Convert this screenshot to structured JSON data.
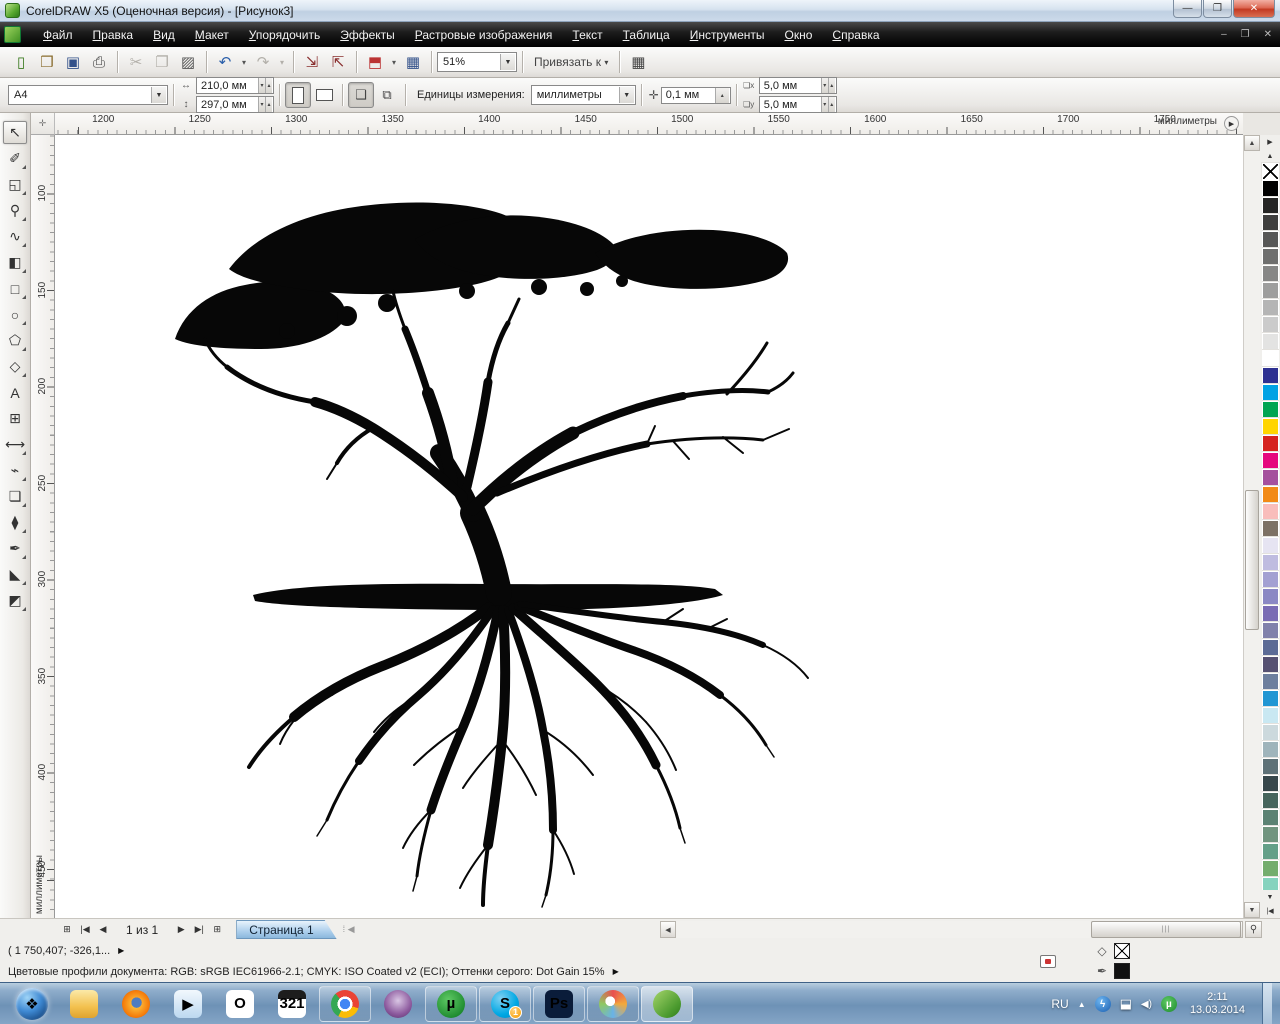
{
  "window": {
    "title": "CorelDRAW X5 (Оценочная версия) - [Рисунок3]",
    "controls": {
      "minimize": "—",
      "restore": "❐",
      "close": "✕"
    }
  },
  "menu": {
    "items": [
      {
        "name": "menu-file",
        "label": "Файл"
      },
      {
        "name": "menu-edit",
        "label": "Правка"
      },
      {
        "name": "menu-view",
        "label": "Вид"
      },
      {
        "name": "menu-layout",
        "label": "Макет"
      },
      {
        "name": "menu-arrange",
        "label": "Упорядочить"
      },
      {
        "name": "menu-effects",
        "label": "Эффекты"
      },
      {
        "name": "menu-bitmaps",
        "label": "Растровые изображения"
      },
      {
        "name": "menu-text",
        "label": "Текст"
      },
      {
        "name": "menu-table",
        "label": "Таблица"
      },
      {
        "name": "menu-tools",
        "label": "Инструменты"
      },
      {
        "name": "menu-window",
        "label": "Окно"
      },
      {
        "name": "menu-help",
        "label": "Справка"
      }
    ],
    "mdi_minimize": "–",
    "mdi_restore": "❐",
    "mdi_close": "✕"
  },
  "toolbar": {
    "buttons": [
      {
        "name": "new-document-icon",
        "glyph": "▯",
        "fg": "#3a7a1f"
      },
      {
        "name": "open-icon",
        "glyph": "❒",
        "fg": "#8a6d2f"
      },
      {
        "name": "save-icon",
        "glyph": "▣",
        "fg": "#33518a"
      },
      {
        "name": "print-icon",
        "glyph": "⎙",
        "fg": "#444"
      },
      {
        "name": "sep"
      },
      {
        "name": "cut-icon",
        "glyph": "✂",
        "fg": "#b3b0aa"
      },
      {
        "name": "copy-icon",
        "glyph": "❐",
        "fg": "#b3b0aa"
      },
      {
        "name": "paste-icon",
        "glyph": "▨",
        "fg": "#555"
      },
      {
        "name": "sep"
      },
      {
        "name": "undo-icon",
        "glyph": "↶",
        "fg": "#2b5faa"
      },
      {
        "name": "undo-dropdown-icon",
        "glyph": "▾",
        "fg": "#555",
        "cls": "small-drop"
      },
      {
        "name": "redo-icon",
        "glyph": "↷",
        "fg": "#b3b0aa"
      },
      {
        "name": "redo-dropdown-icon",
        "glyph": "▾",
        "fg": "#b3b0aa",
        "cls": "small-drop"
      },
      {
        "name": "sep"
      },
      {
        "name": "import-icon",
        "glyph": "⇲",
        "fg": "#8a2f2f"
      },
      {
        "name": "export-icon",
        "glyph": "⇱",
        "fg": "#8a2f2f"
      },
      {
        "name": "sep"
      },
      {
        "name": "application-launcher-icon",
        "glyph": "⬒",
        "fg": "#b33"
      },
      {
        "name": "launcher-dropdown-icon",
        "glyph": "▾",
        "fg": "#555",
        "cls": "small-drop"
      },
      {
        "name": "corel-connect-icon",
        "glyph": "▦",
        "fg": "#33518a"
      }
    ],
    "zoom_value": "51%",
    "snap_label": "Привязать к",
    "snap_dropdown": "▾",
    "options_glyph": "▦"
  },
  "property_bar": {
    "paper_type": "A4",
    "paper_width": "210,0 мм",
    "paper_height": "297,0 мм",
    "units_label": "Единицы измерения:",
    "units_value": "миллиметры",
    "nudge_icon": "✛",
    "nudge_value": "0,1 мм",
    "dup_x_icon": "❏x",
    "duplicate_x": "5,0 мм",
    "dup_y_icon": "❏y",
    "duplicate_y": "5,0 мм"
  },
  "rulers": {
    "origin_glyph": "✛",
    "horizontal_ticks": [
      "1200",
      "1250",
      "1300",
      "1350",
      "1400",
      "1450",
      "1500",
      "1550",
      "1600",
      "1650",
      "1700",
      "1750"
    ],
    "horizontal_unit": "миллиметры",
    "vertical_ticks": [
      "100",
      "150",
      "200",
      "250",
      "300",
      "350",
      "400",
      "450"
    ],
    "vertical_unit": "миллиметры",
    "ruler_options_glyph": "▶"
  },
  "toolbox": {
    "tools": [
      {
        "name": "pick-tool-icon",
        "glyph": "↖",
        "cls": "selected no-flyout"
      },
      {
        "name": "shape-tool-icon",
        "glyph": "✐",
        "cls": ""
      },
      {
        "name": "crop-tool-icon",
        "glyph": "◱",
        "cls": ""
      },
      {
        "name": "zoom-tool-icon",
        "glyph": "⚲",
        "cls": ""
      },
      {
        "name": "freehand-tool-icon",
        "glyph": "∿",
        "cls": ""
      },
      {
        "name": "smart-fill-tool-icon",
        "glyph": "◧",
        "cls": ""
      },
      {
        "name": "rectangle-tool-icon",
        "glyph": "□",
        "cls": ""
      },
      {
        "name": "ellipse-tool-icon",
        "glyph": "○",
        "cls": ""
      },
      {
        "name": "polygon-tool-icon",
        "glyph": "⬠",
        "cls": ""
      },
      {
        "name": "basic-shapes-tool-icon",
        "glyph": "◇",
        "cls": ""
      },
      {
        "name": "text-tool-icon",
        "glyph": "A",
        "cls": "no-flyout"
      },
      {
        "name": "table-tool-icon",
        "glyph": "⊞",
        "cls": "no-flyout"
      },
      {
        "name": "dimension-tool-icon",
        "glyph": "⟷",
        "cls": ""
      },
      {
        "name": "connector-tool-icon",
        "glyph": "⌁",
        "cls": ""
      },
      {
        "name": "blend-tool-icon",
        "glyph": "❏",
        "cls": ""
      },
      {
        "name": "eyedropper-tool-icon",
        "glyph": "⧫",
        "cls": ""
      },
      {
        "name": "outline-pen-tool-icon",
        "glyph": "✒",
        "cls": ""
      },
      {
        "name": "fill-tool-icon",
        "glyph": "◣",
        "cls": ""
      },
      {
        "name": "interactive-fill-tool-icon",
        "glyph": "◩",
        "cls": ""
      }
    ]
  },
  "page_nav": {
    "add_page_start": "⊞",
    "first_page": "|◀",
    "prev_page": "◀",
    "counter": "1 из 1",
    "next_page": "▶",
    "last_page": "▶|",
    "add_page_end": "⊞",
    "tab_label": "Страница 1"
  },
  "status_bar": {
    "coordinates": "( 1 750,407; -326,1...",
    "arrow": "▶",
    "profiles": "Цветовые профили документа: RGB: sRGB IEC61966-2.1; CMYK: ISO Coated v2 (ECI); Оттенки серого: Dot Gain 15%",
    "fill_icon_glyph": "◇",
    "outline_icon_glyph": "✒",
    "fill_value": "none",
    "outline_value": "#111111"
  },
  "palette": {
    "flyout_glyph": "▶",
    "scroll_up_glyph": "▲",
    "scroll_down_glyph": "▼",
    "expand_glyph": "|◀",
    "colors": [
      "#000000",
      "#262625",
      "#3f3f3e",
      "#575756",
      "#6f6f6e",
      "#878786",
      "#9e9e9d",
      "#b5b5b5",
      "#cbcbcb",
      "#e3e3e2",
      "#ffffff",
      "#2e3192",
      "#00a2e4",
      "#00a551",
      "#ffd500",
      "#d6231f",
      "#e5087e",
      "#a5509d",
      "#f28a16",
      "#f9bdbb",
      "#7d7165",
      "#e6e4f2",
      "#bfbce0",
      "#a3a0d2",
      "#8b88c4",
      "#7a6cb4",
      "#8181ab",
      "#5c6b96",
      "#565172",
      "#6d7f9e",
      "#2196d3",
      "#c9e8f2",
      "#ccd9dd",
      "#9fb4bb",
      "#5e7177",
      "#37474b",
      "#46655c",
      "#5b8273",
      "#71957f",
      "#64a088",
      "#74ad6d",
      "#86d3be"
    ]
  },
  "taskbar": {
    "apps": [
      {
        "name": "start-button",
        "glyph": "❖",
        "cls": "orb",
        "bg": "radial-gradient(circle at 35% 30%, #9fd4f7, #3f8ad4 45%, #15457e 85%)",
        "fg": "#ffffff"
      },
      {
        "name": "explorer-icon",
        "glyph": "",
        "cls": "",
        "bg": "linear-gradient(180deg,#fbe9a8,#f3c14f 60%,#dfa32f)",
        "fg": "#fff"
      },
      {
        "name": "firefox-icon",
        "glyph": "",
        "cls": "circle",
        "bg": "radial-gradient(circle at 52% 45%, #4f7cc0 0 24%, transparent 25%), radial-gradient(circle, #ffd24a, #f57c0a 65%, #c2500a)",
        "fg": "#fff"
      },
      {
        "name": "media-player-icon",
        "glyph": "▶",
        "cls": "",
        "bg": "linear-gradient(180deg,#f2f8fd,#bcd8f0)",
        "fg": "#f08019"
      },
      {
        "name": "opera-icon",
        "glyph": "O",
        "cls": "",
        "bg": "#ffffff",
        "fg": "#d6231f"
      },
      {
        "name": "clapperboard-321-icon",
        "glyph": "321",
        "cls": "",
        "bg": "linear-gradient(180deg,#1d1d1d 0 32%, #ffffff 32%)",
        "fg": "#c01818"
      },
      {
        "name": "chrome-icon",
        "glyph": "",
        "cls": "boxed circle",
        "bg": "radial-gradient(circle, #4285f4 0 26%, #ffffff 26% 38%, transparent 38%), conic-gradient(#ea4335 0 30%, #fbbc05 30% 58%, #34a853 58% 88%, #ea4335 88%)",
        "fg": "#fff"
      },
      {
        "name": "tor-icon",
        "glyph": "",
        "cls": "circle",
        "bg": "radial-gradient(circle at 50% 38%, #d9c6e4, #8d5a9e 60%, #55306b)",
        "fg": "#fff"
      },
      {
        "name": "utorrent-icon",
        "glyph": "µ",
        "cls": "boxed circle",
        "bg": "radial-gradient(circle at 40% 35%, #5ec964, #1d8a2e 75%)",
        "fg": "#ffffff"
      },
      {
        "name": "skype-icon",
        "glyph": "S",
        "cls": "boxed circle",
        "bg": "radial-gradient(circle at 35% 30%, #7ed0f2, #00a8e4 60%, #0086c3)",
        "fg": "#ffffff",
        "badge": "1"
      },
      {
        "name": "photoshop-icon",
        "glyph": "Ps",
        "cls": "boxed",
        "bg": "#0a1c3a",
        "fg": "#9cc6f0"
      },
      {
        "name": "paint-icon",
        "glyph": "",
        "cls": "boxed circle",
        "bg": "radial-gradient(circle at 40% 40%, #ffffff 0 20%, transparent 21%), conic-gradient(#e94f4f, #f2a93b, #69b2e8, #8ec963, #e94f4f)",
        "fg": "#fff"
      },
      {
        "name": "coreldraw-icon",
        "glyph": "",
        "cls": "boxed active circle",
        "bg": "linear-gradient(135deg,#a5d46a,#4c9b2f 70%,#2f7a1a)",
        "fg": "#fff"
      }
    ],
    "tray": {
      "lang": "RU",
      "caret": "▲",
      "flash_glyph": "ϟ",
      "network_glyph": "⬓",
      "volume_glyph": "◀)",
      "utorrent_tray_glyph": "µ",
      "time": "2:11",
      "date": "13.03.2014"
    }
  }
}
